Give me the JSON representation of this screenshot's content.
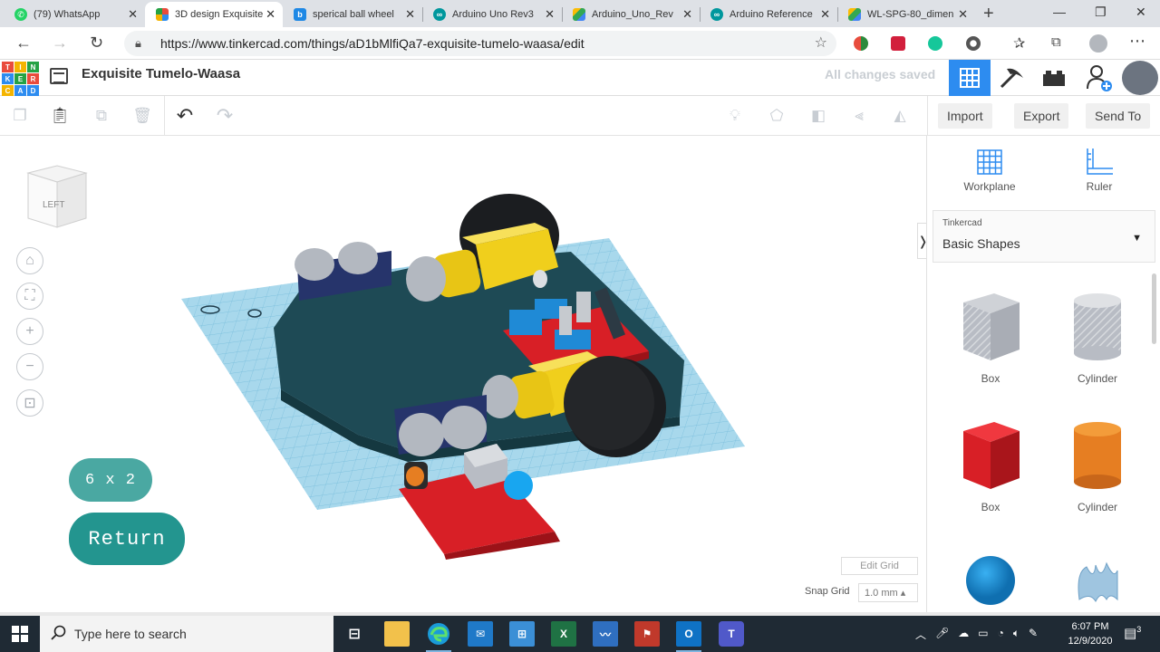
{
  "browser": {
    "tabs": [
      {
        "title": "(79) WhatsApp",
        "icon": "whatsapp-icon",
        "color": "#25d366"
      },
      {
        "title": "3D design Exquisite",
        "icon": "tinkercad-icon",
        "color": "#e94b3c",
        "active": true
      },
      {
        "title": "sperical ball wheel",
        "icon": "bing-icon",
        "color": "#1e88e5"
      },
      {
        "title": "Arduino Uno Rev3",
        "icon": "arduino-icon",
        "color": "#00979d"
      },
      {
        "title": "Arduino_Uno_Rev",
        "icon": "drive-icon",
        "color": "#fbbc04"
      },
      {
        "title": "Arduino Reference",
        "icon": "arduino-icon",
        "color": "#00979d"
      },
      {
        "title": "WL-SPG-80_dimen",
        "icon": "drive-icon",
        "color": "#fbbc04"
      }
    ],
    "url": "https://www.tinkercad.com/things/aD1bMlfiQa7-exquisite-tumelo-waasa/edit"
  },
  "header": {
    "logo_letters": [
      "T",
      "I",
      "N",
      "K",
      "E",
      "R",
      "C",
      "A",
      "D"
    ],
    "title": "Exquisite Tumelo-Waasa",
    "save_status": "All changes saved"
  },
  "toolbar": {
    "actions": [
      "Import",
      "Export",
      "Send To"
    ]
  },
  "workspace": {
    "viewcube_label": "LEFT",
    "dimension_label": "6 x 2",
    "return_label": "Return",
    "edit_grid_label": "Edit Grid",
    "snap_grid_label": "Snap Grid",
    "snap_grid_value": "1.0 mm ▴",
    "collapse_arrow": "❭"
  },
  "panel": {
    "tools": [
      "Workplane",
      "Ruler"
    ],
    "library_category": "Tinkercad",
    "library_name": "Basic Shapes",
    "shapes": [
      {
        "label": "Box",
        "kind": "box",
        "color": "#b8bcc4"
      },
      {
        "label": "Cylinder",
        "kind": "cylinder",
        "color": "#b8bcc4"
      },
      {
        "label": "Box",
        "kind": "box",
        "color": "#d81f26"
      },
      {
        "label": "Cylinder",
        "kind": "cylinder",
        "color": "#e67e22"
      },
      {
        "label": "",
        "kind": "sphere",
        "color": "#1a8fd6"
      },
      {
        "label": "",
        "kind": "scribble",
        "color": "#8ab6d6"
      }
    ]
  },
  "taskbar": {
    "search_placeholder": "Type here to search",
    "time": "6:07 PM",
    "date": "12/9/2020",
    "notification_count": "3"
  }
}
